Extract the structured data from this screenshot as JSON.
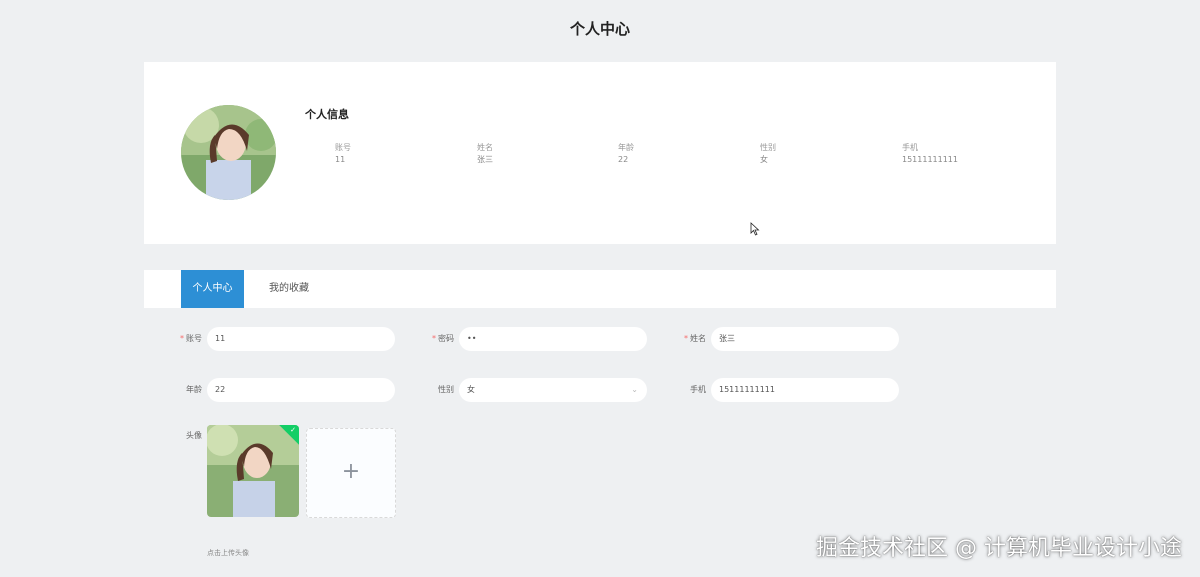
{
  "page": {
    "title": "个人中心"
  },
  "profile": {
    "section_title": "个人信息",
    "fields": [
      {
        "label": "账号",
        "value": "11"
      },
      {
        "label": "姓名",
        "value": "张三"
      },
      {
        "label": "年龄",
        "value": "22"
      },
      {
        "label": "性别",
        "value": "女"
      },
      {
        "label": "手机",
        "value": "15111111111"
      }
    ]
  },
  "tabs": [
    {
      "label": "个人中心",
      "active": true
    },
    {
      "label": "我的收藏",
      "active": false
    }
  ],
  "form": {
    "account": {
      "label": "账号",
      "value": "11",
      "required": true
    },
    "password": {
      "label": "密码",
      "value": "••",
      "required": true
    },
    "name": {
      "label": "姓名",
      "value": "张三",
      "required": true
    },
    "age": {
      "label": "年龄",
      "value": "22"
    },
    "gender": {
      "label": "性别",
      "value": "女"
    },
    "phone": {
      "label": "手机",
      "value": "15111111111"
    },
    "avatar": {
      "label": "头像",
      "add_symbol": "+",
      "hint": "点击上传头像"
    }
  },
  "colors": {
    "accent": "#2d8fd5",
    "required": "#f56c6c",
    "success": "#13ce66",
    "background": "#eef0f2"
  },
  "watermark": "掘金技术社区 @ 计算机毕业设计小途"
}
